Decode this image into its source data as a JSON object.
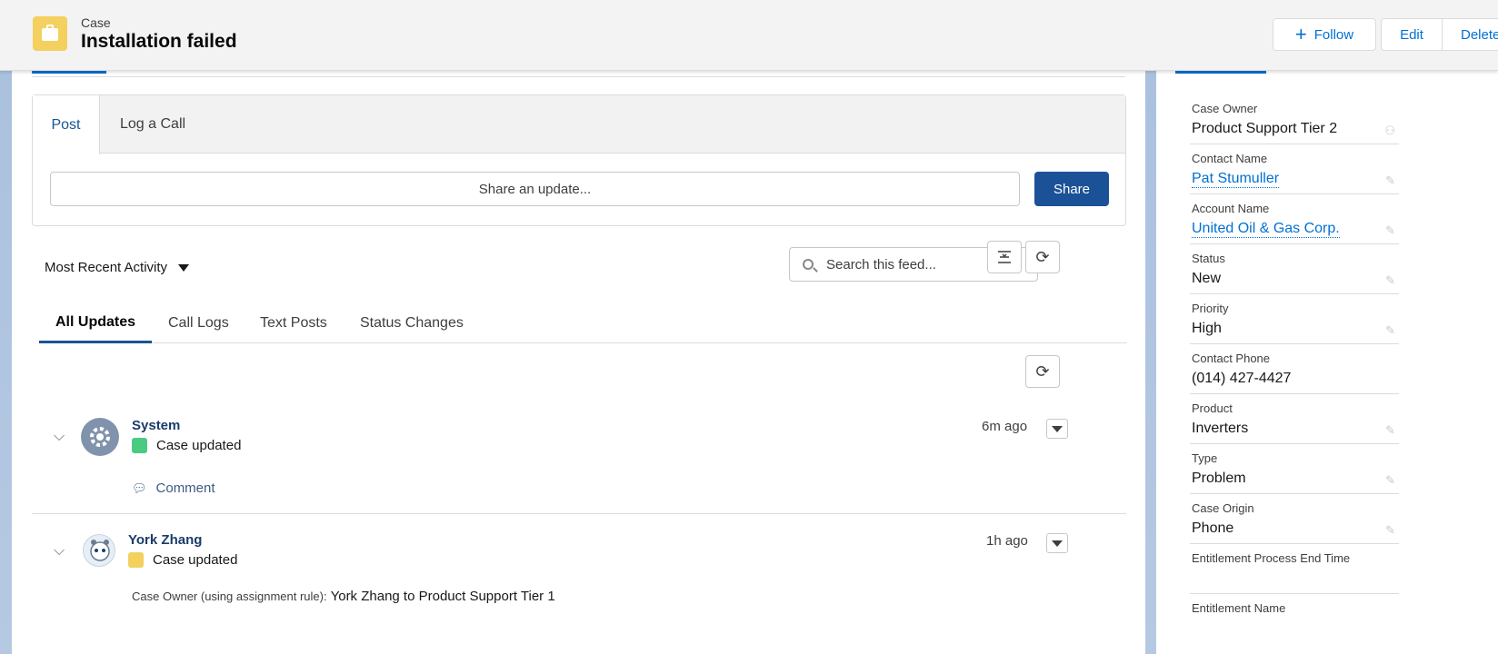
{
  "header": {
    "object_label": "Case",
    "record_title": "Installation failed",
    "follow_label": "Follow",
    "edit_label": "Edit",
    "delete_label": "Delete"
  },
  "publisher": {
    "tabs": [
      "Post",
      "Log a Call"
    ],
    "input_placeholder": "Share an update...",
    "share_label": "Share"
  },
  "feed_controls": {
    "sort_label": "Most Recent Activity",
    "search_placeholder": "Search this feed..."
  },
  "feed_tabs": [
    "All Updates",
    "Call Logs",
    "Text Posts",
    "Status Changes"
  ],
  "feed_items": [
    {
      "author": "System",
      "time": "6m ago",
      "message": "Case updated",
      "action": "Comment",
      "icon_color": "#4bca81"
    },
    {
      "author": "York Zhang",
      "time": "1h ago",
      "message": "Case updated",
      "detail_label": "Case Owner (using assignment rule):",
      "detail_value": "York Zhang to Product Support Tier 1",
      "icon_color": "#f4d05e"
    }
  ],
  "details": [
    {
      "label": "Case Owner",
      "value": "Product Support Tier 2"
    },
    {
      "label": "Contact Name",
      "value": "Pat Stumuller"
    },
    {
      "label": "Account Name",
      "value": "United Oil & Gas Corp."
    },
    {
      "label": "Status",
      "value": "New"
    },
    {
      "label": "Priority",
      "value": "High"
    },
    {
      "label": "Contact Phone",
      "value": "(014) 427-4427"
    },
    {
      "label": "Product",
      "value": "Inverters"
    },
    {
      "label": "Type",
      "value": "Problem"
    },
    {
      "label": "Case Origin",
      "value": "Phone"
    },
    {
      "label": "Entitlement Process End Time",
      "value": ""
    },
    {
      "label": "Entitlement Name",
      "value": ""
    }
  ],
  "colors": {
    "brand_blue": "#1b5297",
    "link_blue": "#0070d2",
    "case_icon": "#f4d05e"
  }
}
